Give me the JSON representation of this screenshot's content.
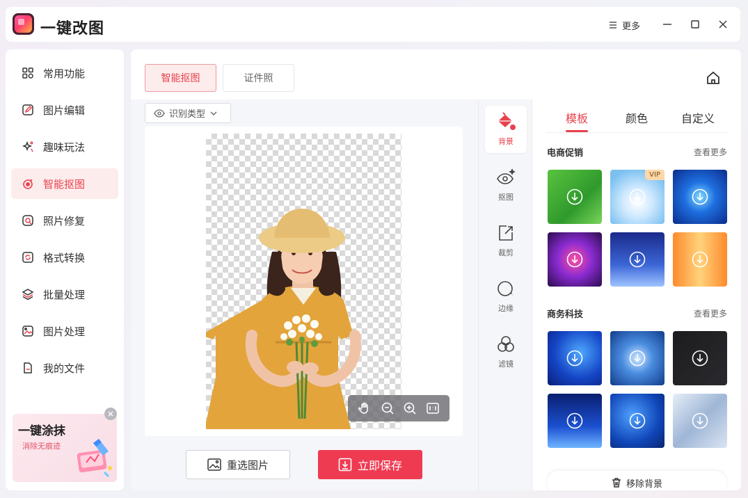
{
  "app": {
    "title": "一键改图",
    "more_label": "更多"
  },
  "sidebar": {
    "items": [
      {
        "label": "常用功能",
        "icon": "grid-icon"
      },
      {
        "label": "图片编辑",
        "icon": "edit-icon"
      },
      {
        "label": "趣味玩法",
        "icon": "sparkle-icon"
      },
      {
        "label": "智能抠图",
        "icon": "cutout-icon",
        "active": true
      },
      {
        "label": "照片修复",
        "icon": "repair-icon"
      },
      {
        "label": "格式转换",
        "icon": "convert-icon"
      },
      {
        "label": "批量处理",
        "icon": "layers-icon"
      },
      {
        "label": "图片处理",
        "icon": "image-icon"
      },
      {
        "label": "我的文件",
        "icon": "file-icon"
      }
    ],
    "promo": {
      "title": "一键涂抹",
      "subtitle": "消除无痕迹"
    }
  },
  "tabs": [
    {
      "label": "智能抠图",
      "active": true
    },
    {
      "label": "证件照"
    }
  ],
  "canvas": {
    "type_select_label": "识别类型",
    "reselect_label": "重选图片",
    "save_label": "立即保存"
  },
  "tools": [
    {
      "label": "背景",
      "icon": "paint-bucket-icon",
      "active": true
    },
    {
      "label": "抠图",
      "icon": "eye-sparkle-icon"
    },
    {
      "label": "裁剪",
      "icon": "crop-icon"
    },
    {
      "label": "边缘",
      "icon": "edge-icon"
    },
    {
      "label": "滤镜",
      "icon": "filter-icon"
    }
  ],
  "panel": {
    "tabs": [
      {
        "label": "模板",
        "active": true
      },
      {
        "label": "颜色"
      },
      {
        "label": "自定义"
      }
    ],
    "sections": [
      {
        "title": "电商促销",
        "see_more": "查看更多"
      },
      {
        "title": "商务科技",
        "see_more": "查看更多"
      }
    ],
    "vip_label": "VIP",
    "remove_bg_label": "移除背景"
  },
  "colors": {
    "accent": "#e8424d",
    "save_button": "#ef3b52"
  }
}
